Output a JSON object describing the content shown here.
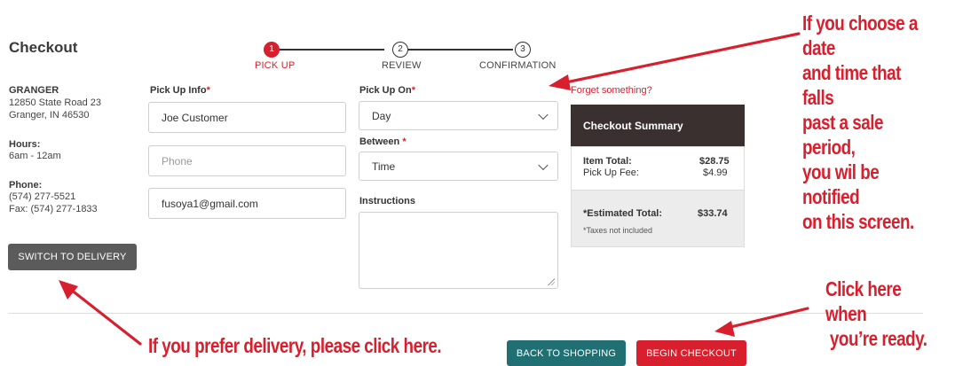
{
  "title": "Checkout",
  "stepper": {
    "steps": [
      {
        "number": "1",
        "label": "PICK UP",
        "active": true
      },
      {
        "number": "2",
        "label": "REVIEW",
        "active": false
      },
      {
        "number": "3",
        "label": "CONFIRMATION",
        "active": false
      }
    ]
  },
  "store": {
    "name": "GRANGER",
    "address1": "12850 State Road 23",
    "address2": "Granger, IN 46530",
    "hours_label": "Hours:",
    "hours": "6am - 12am",
    "phone_label": "Phone:",
    "phone": "(574) 277-5521",
    "fax": "Fax: (574) 277-1833",
    "switch_button": "SWITCH TO DELIVERY"
  },
  "pickup_info": {
    "label": "Pick Up Info",
    "name_value": "Joe Customer",
    "phone_placeholder": "Phone",
    "email_value": "fusoya1@gmail.com"
  },
  "pickup_on": {
    "label": "Pick Up On",
    "day_value": "Day",
    "between_label": "Between",
    "time_value": "Time",
    "instructions_label": "Instructions"
  },
  "forget_link": "Forget something?",
  "summary": {
    "header": "Checkout Summary",
    "item_total_label": "Item Total:",
    "item_total_value": "$28.75",
    "pickup_fee_label": "Pick Up Fee:",
    "pickup_fee_value": "$4.99",
    "estimated_label": "*Estimated Total:",
    "estimated_value": "$33.74",
    "taxes_note": "*Taxes not included"
  },
  "actions": {
    "back": "BACK TO SHOPPING",
    "begin": "BEGIN CHECKOUT"
  },
  "callouts": {
    "date_line1": "If you choose a date",
    "date_line2": "and time that falls",
    "date_line3": "past a sale period,",
    "date_line4": "you wil be notified",
    "date_line5": "on this screen.",
    "ready_line1": "Click here when",
    "ready_line2": "you’re ready.",
    "delivery": "If you prefer delivery, please click here."
  },
  "colors": {
    "accent": "#d81f2e",
    "teal": "#1f6f73",
    "dark": "#3a3030"
  }
}
